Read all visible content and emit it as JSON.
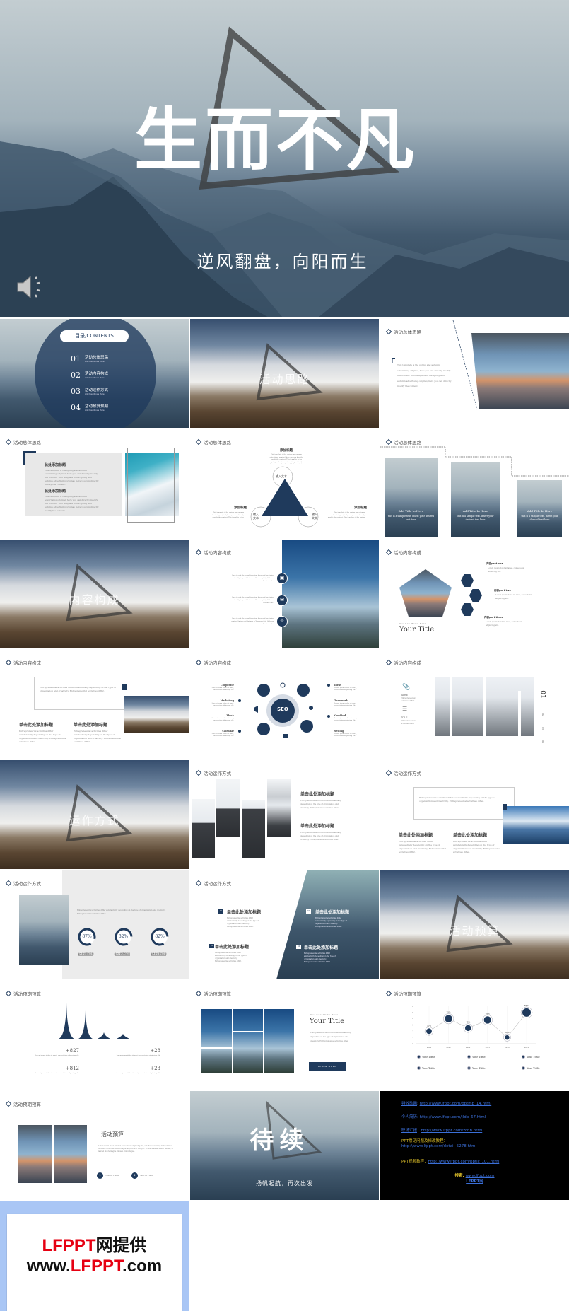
{
  "colors": {
    "accent": "#1f3a5c",
    "banner_bg": "#a9c6f5",
    "brand_red": "#e60012"
  },
  "hero": {
    "title": "生而不凡",
    "subtitle": "逆风翻盘，向阳而生",
    "icon": "speaker-icon"
  },
  "contents": {
    "pill": "目录/CONTENTS",
    "items": [
      {
        "num": "01",
        "title": "活动总体思路",
        "sub": "Add Headlines Here"
      },
      {
        "num": "02",
        "title": "活动内容构成",
        "sub": "Add Headlines Here"
      },
      {
        "num": "03",
        "title": "活动运作方式",
        "sub": "Add Headlines Here"
      },
      {
        "num": "04",
        "title": "活动预算预期",
        "sub": "Add Headlines Here"
      }
    ]
  },
  "covers": {
    "c1": "活动思路",
    "c2": "内容构成",
    "c3": "运作方式",
    "c4": "活动预算"
  },
  "headings": {
    "h1": "活动总体思路",
    "h2": "活动内容构成",
    "h3": "活动运作方式",
    "h4": "活动预期预算"
  },
  "lorem": {
    "template": "This template is the spring and autumn advertising original, here you can directly modify the content. This template is the spring and autumn advertising original, here you can directly modify the content.",
    "entre": "Entrepreneurial activities differ substantially depending on the type of organization and creativity. Entrepreneurial activities differ.",
    "short": "Lorem ipsum dolor sit amet, consectetur adipiscing elit.",
    "easy": "Easy to edit the template editor, focus and specialize content Spring and Autumn in Wuzhang City, Sichuan Province ads.",
    "ipsum": "Lorem ipsum dolor sit amet consectetur adipiscing elit, sed diam nonummy nibh euismod tincidunt ut laoreet dolore magna aliquam erat volutpat. Ut wisi enim ad minim veniam, ut laoreet dolore magna aliquam erat volutpat."
  },
  "s3": {
    "add_title": "此处添加标题"
  },
  "s5": {
    "label": "添加标题",
    "input_top": "输入文本",
    "input_side": "输入文本"
  },
  "s6": {
    "card_title": "Add Title In Here",
    "card_text": "this is a sample text. insert your desired text here"
  },
  "s9": {
    "small": "You Can Write Here",
    "title": "Your Title",
    "parts": [
      "内容part one",
      "内容part two",
      "内容part three"
    ]
  },
  "click_title": "单击此处添加标题",
  "s11": {
    "center": "SEO",
    "left": [
      "Cooperate",
      "Marketing",
      "Think",
      "Calendar"
    ],
    "right": [
      "Ideas",
      "Teamwork",
      "Goodbad",
      "Setting"
    ]
  },
  "s12": {
    "name": "NAME",
    "title": "TITLE",
    "num": "01",
    "nums": [
      "02",
      "03",
      "04"
    ],
    "sub": "Entrepreneurial activities differ"
  },
  "s16": {
    "rings": [
      {
        "label": "87%",
        "value": 87
      },
      {
        "label": "82%",
        "value": 82
      },
      {
        "label": "82%",
        "value": 82
      }
    ]
  },
  "s17": {
    "nums": [
      "01",
      "02",
      "03",
      "04"
    ]
  },
  "s19": {
    "stats": [
      "+827",
      "+28",
      "+812",
      "+23"
    ]
  },
  "s20": {
    "small": "You Can Write Here",
    "title": "Your Title",
    "button": "LEARN MORE"
  },
  "chart_data": {
    "type": "line",
    "x": [
      "2010",
      "2011",
      "2012",
      "2013",
      "2014",
      "2015"
    ],
    "values": [
      2,
      4,
      2.5,
      3.8,
      1,
      5
    ],
    "data_labels": [
      "30%",
      "75%",
      "45%",
      "65%",
      "20%",
      "87%"
    ],
    "ylim": [
      0,
      6
    ],
    "yticks": [
      "0",
      "1",
      "2",
      "3",
      "4",
      "5",
      "6"
    ],
    "legend": [
      "Your Tittle",
      "Your Tittle",
      "Your Tittle",
      "Your Tittle",
      "Your Tittle",
      "Your Tittle"
    ],
    "legend_placement": "bottom"
  },
  "s22": {
    "title": "活动预算",
    "items": [
      "Text in Here",
      "Text in Here"
    ],
    "nums": [
      "1",
      "2"
    ]
  },
  "s23": {
    "title": "待续",
    "subtitle": "扬帆起航，再次出发"
  },
  "links": [
    {
      "label": "特效动画",
      "sep": ": ",
      "url": "http://www.lfppt.com/pptmb_14.html"
    },
    {
      "label": "个人简历",
      "sep": ": ",
      "url": "http://www.lfppt.com/jldb_67.html"
    },
    {
      "label": "职场汇报",
      "sep": "：",
      "url": "http://www.lfppt.com/zchb.html"
    }
  ],
  "faq": {
    "label": "PPT常见问题及修改教程：",
    "url": "http://www.lfppt.com/detail_5278.html"
  },
  "video": {
    "label": "PPT视频教程：",
    "url": "http://www.lfppt.com/pptjc_101.html"
  },
  "search": {
    "label": "搜索: ",
    "url": "www.lfppt.com",
    "brand": "LFPPT网"
  },
  "banner": {
    "line1_brand": "LFPPT",
    "line1_rest": "网提供",
    "line2_pre": "www.",
    "line2_brand": "LFPPT",
    "line2_post": ".com"
  }
}
